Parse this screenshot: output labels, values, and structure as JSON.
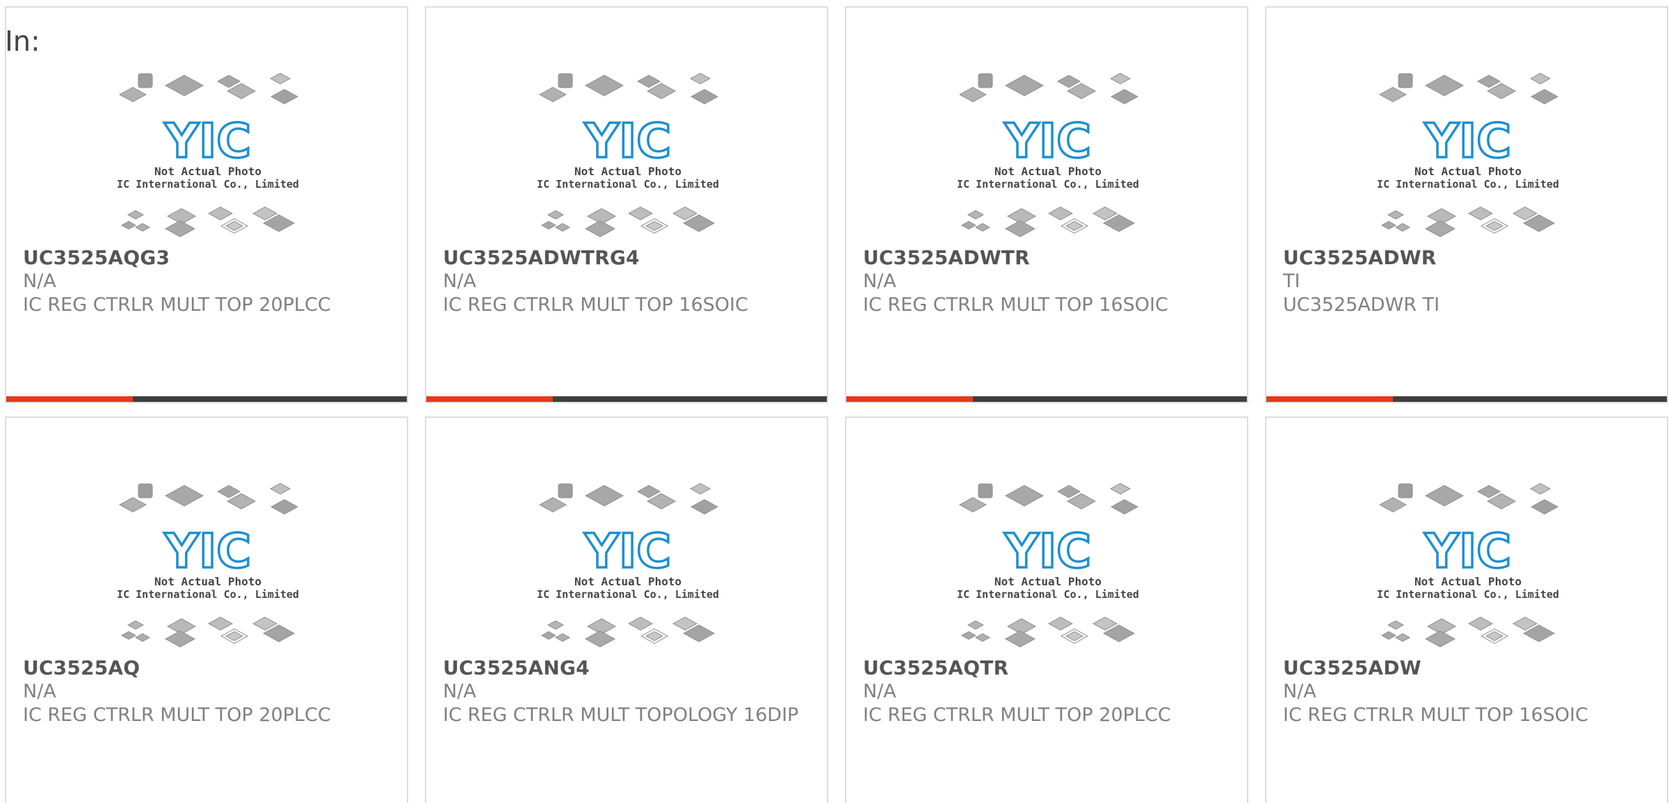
{
  "header": {
    "label": "In:"
  },
  "placeholder": {
    "line1": "Not Actual Photo",
    "line2": "YIC International Co., Limited.",
    "logo_text": "YIC"
  },
  "colors": {
    "accent": "#e6391b",
    "bar": "#3f3f3f",
    "logo": "#1c8fd2"
  },
  "products": [
    {
      "part": "UC3525AQG3",
      "manufacturer": "N/A",
      "description": "IC REG CTRLR MULT TOP 20PLCC",
      "has_bar": true
    },
    {
      "part": "UC3525ADWTRG4",
      "manufacturer": "N/A",
      "description": "IC REG CTRLR MULT TOP 16SOIC",
      "has_bar": true
    },
    {
      "part": "UC3525ADWTR",
      "manufacturer": "N/A",
      "description": "IC REG CTRLR MULT TOP 16SOIC",
      "has_bar": true
    },
    {
      "part": "UC3525ADWR",
      "manufacturer": "TI",
      "description": "UC3525ADWR TI",
      "has_bar": true
    },
    {
      "part": "UC3525AQ",
      "manufacturer": "N/A",
      "description": "IC REG CTRLR MULT TOP 20PLCC",
      "has_bar": false
    },
    {
      "part": "UC3525ANG4",
      "manufacturer": "N/A",
      "description": "IC REG CTRLR MULT TOPOLOGY 16DIP",
      "has_bar": false
    },
    {
      "part": "UC3525AQTR",
      "manufacturer": "N/A",
      "description": "IC REG CTRLR MULT TOP 20PLCC",
      "has_bar": false
    },
    {
      "part": "UC3525ADW",
      "manufacturer": "N/A",
      "description": "IC REG CTRLR MULT TOP 16SOIC",
      "has_bar": false
    }
  ]
}
